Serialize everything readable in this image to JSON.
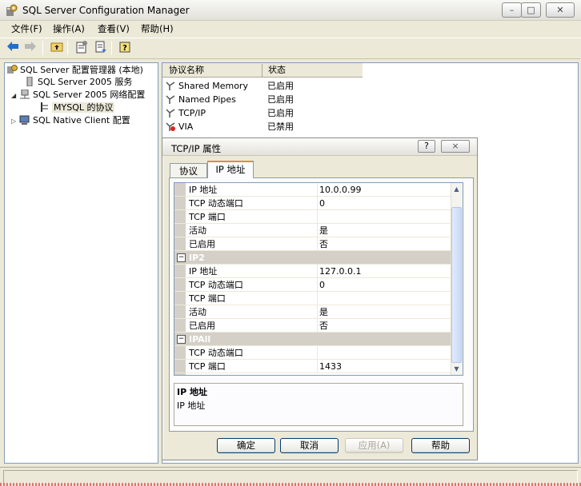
{
  "window": {
    "title": "SQL Server Configuration Manager"
  },
  "menubar": {
    "file": "文件(F)",
    "action": "操作(A)",
    "view": "查看(V)",
    "help": "帮助(H)"
  },
  "toolbar": {
    "icons": [
      "back-arrow-icon",
      "forward-arrow-icon",
      "up-folder-icon",
      "properties-icon",
      "export-list-icon",
      "help-icon"
    ]
  },
  "tree": {
    "root": "SQL Server 配置管理器 (本地)",
    "services": "SQL Server 2005 服务",
    "network": "SQL Server 2005 网络配置",
    "mysql_protocols": "MYSQL 的协议",
    "native_client": "SQL Native Client 配置"
  },
  "list": {
    "headers": {
      "name": "协议名称",
      "status": "状态"
    },
    "rows": [
      {
        "name": "Shared Memory",
        "status": "已启用"
      },
      {
        "name": "Named Pipes",
        "status": "已启用"
      },
      {
        "name": "TCP/IP",
        "status": "已启用"
      },
      {
        "name": "VIA",
        "status": "已禁用"
      }
    ]
  },
  "dialog": {
    "title": "TCP/IP 属性",
    "help_glyph": "?",
    "close_glyph": "×",
    "tabs": {
      "protocol": "协议",
      "ip_address": "IP 地址"
    },
    "grid": {
      "rows1": [
        {
          "name": "IP 地址",
          "value": "10.0.0.99"
        },
        {
          "name": "TCP 动态端口",
          "value": "0"
        },
        {
          "name": "TCP 端口",
          "value": ""
        },
        {
          "name": "活动",
          "value": "是"
        },
        {
          "name": "已启用",
          "value": "否"
        }
      ],
      "cat_ip2": "IP2",
      "rows2": [
        {
          "name": "IP 地址",
          "value": "127.0.0.1"
        },
        {
          "name": "TCP 动态端口",
          "value": "0"
        },
        {
          "name": "TCP 端口",
          "value": ""
        },
        {
          "name": "活动",
          "value": "是"
        },
        {
          "name": "已启用",
          "value": "否"
        }
      ],
      "cat_ipall": "IPAll",
      "rows3": [
        {
          "name": "TCP 动态端口",
          "value": ""
        },
        {
          "name": "TCP 端口",
          "value": "1433"
        }
      ]
    },
    "description": {
      "title": "IP 地址",
      "text": "IP 地址"
    },
    "buttons": {
      "ok": "确定",
      "cancel": "取消",
      "apply": "应用(A)",
      "help": "帮助"
    }
  },
  "colors": {
    "accent_tab": "#e68b2c",
    "border_blue": "#7f9db9",
    "face": "#ece9d8"
  }
}
